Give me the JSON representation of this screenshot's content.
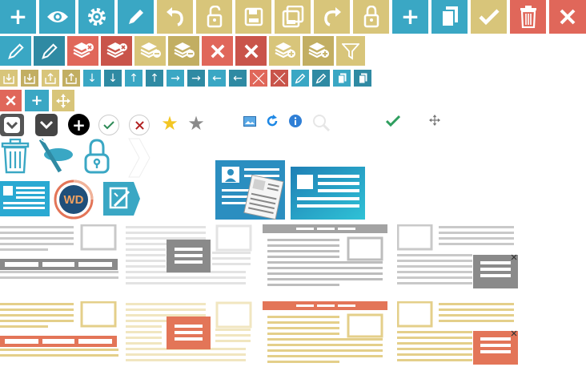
{
  "colors": {
    "teal": "#3aa7c4",
    "teal_dark": "#2f8aa3",
    "sand": "#d8c57a",
    "sand_dark": "#c2ae62",
    "red": "#e0675a",
    "red_dark": "#c9544a",
    "grey_line": "#bdbdbd",
    "gold_line": "#e4cf8a",
    "orange": "#e37558",
    "navy": "#1f4f7a"
  },
  "row1_icons": [
    "plus-icon",
    "eye-icon",
    "gear-icon",
    "pencil-icon",
    "undo-icon",
    "unlock-icon",
    "save-icon",
    "save-all-icon",
    "redo-icon",
    "lock-icon",
    "plus-icon",
    "copy-icon",
    "check-icon",
    "trash-icon",
    "close-icon"
  ],
  "row2_icons": [
    "pencil-icon",
    "pencil-icon",
    "layers-remove-icon",
    "layers-remove-icon",
    "layers-minus-icon",
    "layers-minus-icon",
    "close-icon",
    "close-icon",
    "layers-add-icon",
    "layers-add-icon",
    "filter-icon"
  ],
  "row3_icons": [
    "import-icon",
    "import-icon",
    "export-icon",
    "export-icon",
    "arrow-down-icon",
    "arrow-down-icon",
    "arrow-up-icon",
    "arrow-up-icon",
    "arrow-right-icon",
    "arrow-right-icon",
    "arrow-left-icon",
    "arrow-left-icon",
    "resize-icon",
    "resize-icon",
    "pencil-icon",
    "pencil-icon",
    "copy-icon",
    "copy-icon"
  ],
  "row4_icons": [
    "close-icon",
    "plus-icon",
    "move-icon"
  ],
  "row5_icons": [
    "dropdown-icon",
    "dropdown-icon",
    "add-circle-icon",
    "check-circle-icon",
    "close-circle-icon",
    "star-icon",
    "star-icon",
    "image-icon",
    "refresh-icon",
    "info-icon",
    "search-icon",
    "check-icon",
    "move-icon"
  ],
  "badge": {
    "text": "WD"
  }
}
